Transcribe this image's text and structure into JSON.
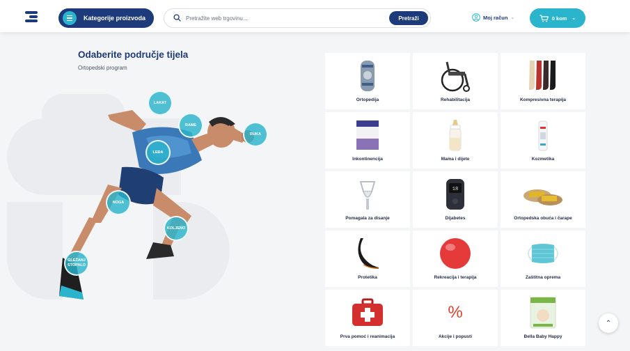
{
  "header": {
    "categories_label": "Kategorije proizvoda",
    "search_placeholder": "Pretražite web trgovinu...",
    "search_button": "Pretraži",
    "account_label": "Moj račun",
    "cart_label": "0 kom"
  },
  "hero": {
    "title": "Odaberite područje tijela",
    "subtitle": "Ortopedski program",
    "spots": [
      "LAKAT",
      "RAME",
      "RUKA",
      "LEĐA",
      "NOGA",
      "KOLJENO",
      "GLEŽANJ STOPALO"
    ]
  },
  "categories": [
    {
      "label": "Ortopedija",
      "icon": "knee-brace-icon"
    },
    {
      "label": "Rehabilitacija",
      "icon": "wheelchair-icon"
    },
    {
      "label": "Kompresivna terapija",
      "icon": "stockings-icon"
    },
    {
      "label": "Inkontinencija",
      "icon": "diaper-pack-icon"
    },
    {
      "label": "Mama i dijete",
      "icon": "baby-bottle-icon"
    },
    {
      "label": "Kozmetika",
      "icon": "cosmetic-bottle-icon"
    },
    {
      "label": "Pomagala za disanje",
      "icon": "breathing-mask-icon"
    },
    {
      "label": "Dijabetes",
      "icon": "glucose-meter-icon"
    },
    {
      "label": "Ortopedska obuća i čarape",
      "icon": "sandals-icon"
    },
    {
      "label": "Protetika",
      "icon": "prosthetic-foot-icon"
    },
    {
      "label": "Rekreacija i terapija",
      "icon": "exercise-ball-icon"
    },
    {
      "label": "Zaštitna oprema",
      "icon": "face-mask-icon"
    },
    {
      "label": "Prva pomoć i reanimacija",
      "icon": "first-aid-kit-icon"
    },
    {
      "label": "Akcije i popusti",
      "icon": "percent-icon",
      "symbol": "%"
    },
    {
      "label": "Bella Baby Happy",
      "icon": "baby-diapers-icon"
    }
  ],
  "colors": {
    "primary": "#1d3a7a",
    "accent": "#2bb5cc",
    "sale": "#d9432b"
  }
}
